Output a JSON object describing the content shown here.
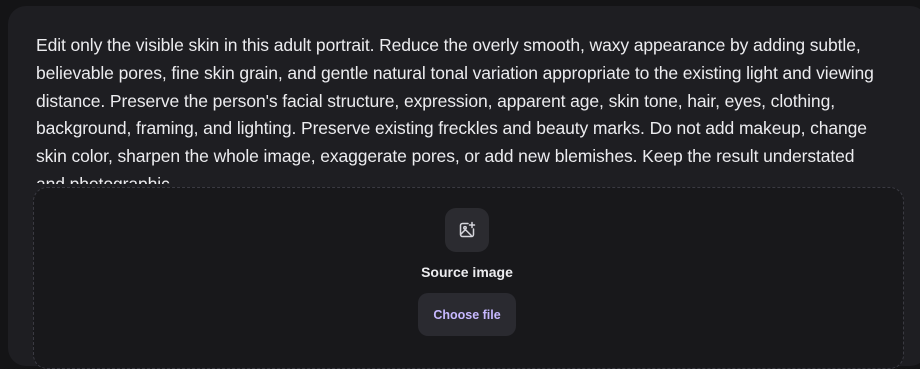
{
  "prompt": {
    "text": "Edit only the visible skin in this adult portrait. Reduce the overly smooth, waxy appearance by adding subtle, believable pores, fine skin grain, and gentle natural tonal variation appropriate to the existing light and viewing distance. Preserve the person's facial structure, expression, apparent age, skin tone, hair, eyes, clothing, background, framing, and lighting. Preserve existing freckles and beauty marks. Do not add makeup, change skin color, sharpen the whole image, exaggerate pores, or add new blemishes. Keep the result understated and photographic."
  },
  "upload": {
    "icon": "image-add-icon",
    "label": "Source image",
    "button_label": "Choose file"
  },
  "colors": {
    "background": "#141416",
    "panel": "#1e1e22",
    "text": "#ececef",
    "accent": "#c7b8ff"
  }
}
